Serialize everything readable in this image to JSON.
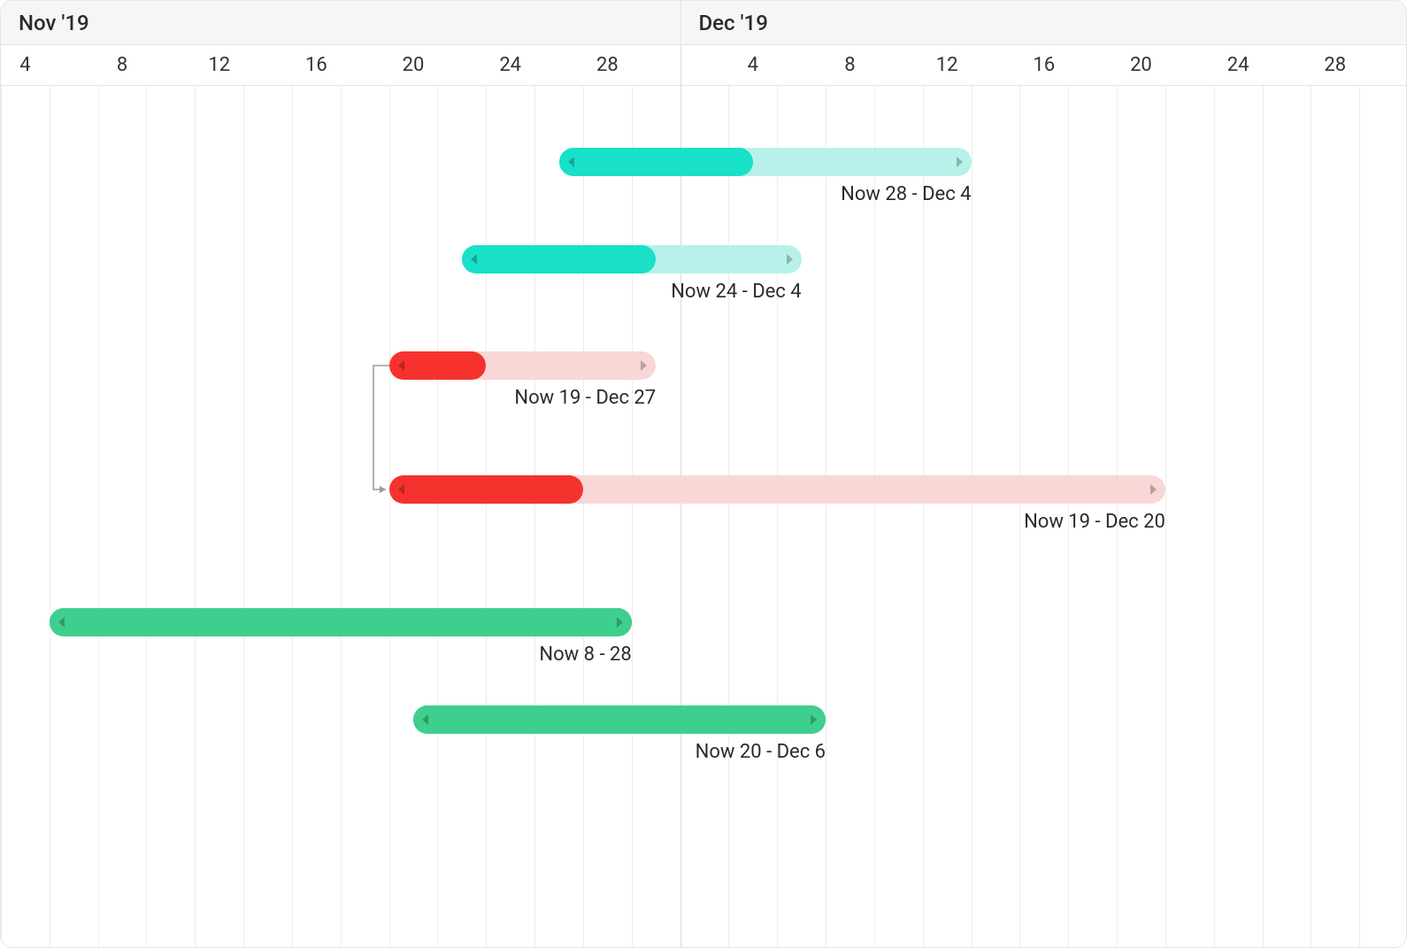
{
  "timeline": {
    "start_month": "Nov",
    "start_day": 3,
    "end_month": "Dec",
    "end_day": 30,
    "months": [
      {
        "label": "Nov '19",
        "span_days": 28
      },
      {
        "label": "Dec '19",
        "span_days": 30
      }
    ],
    "day_ticks": [
      4,
      8,
      12,
      16,
      20,
      24,
      28
    ],
    "month_split_day": {
      "month": "Dec",
      "day": 1
    }
  },
  "colors": {
    "teal": "#19e0c9",
    "teal_track": "#b8f1e9",
    "red": "#f6322e",
    "red_track": "#f9d7d6",
    "green": "#3ecf8e",
    "green_track": "#3ecf8e"
  },
  "chart_data": {
    "type": "gantt",
    "x_unit": "date",
    "x_range": {
      "start": "2019-11-03",
      "end": "2019-12-30"
    },
    "tasks": [
      {
        "id": 1,
        "color": "teal",
        "start": "2019-11-26",
        "end": "2019-12-12",
        "progress_end": "2019-12-03",
        "row": 0,
        "label": "Now 28 - Dec 4"
      },
      {
        "id": 2,
        "color": "teal",
        "start": "2019-11-22",
        "end": "2019-12-05",
        "progress_end": "2019-11-29",
        "row": 1,
        "label": "Now 24 - Dec 4"
      },
      {
        "id": 3,
        "color": "red",
        "start": "2019-11-19",
        "end": "2019-11-29",
        "progress_end": "2019-11-22",
        "row": 2,
        "label": "Now 19 - Dec 27"
      },
      {
        "id": 4,
        "color": "red",
        "start": "2019-11-19",
        "end": "2019-12-20",
        "progress_end": "2019-11-26",
        "row": 3,
        "label": "Now 19 - Dec 20",
        "depends_on": 3
      },
      {
        "id": 5,
        "color": "green",
        "start": "2019-11-05",
        "end": "2019-11-28",
        "progress_end": "2019-11-28",
        "row": 4,
        "label": "Now 8 - 28"
      },
      {
        "id": 6,
        "color": "green",
        "start": "2019-11-20",
        "end": "2019-12-06",
        "progress_end": "2019-12-06",
        "row": 5,
        "label": "Now 20 - Dec 6"
      }
    ]
  }
}
